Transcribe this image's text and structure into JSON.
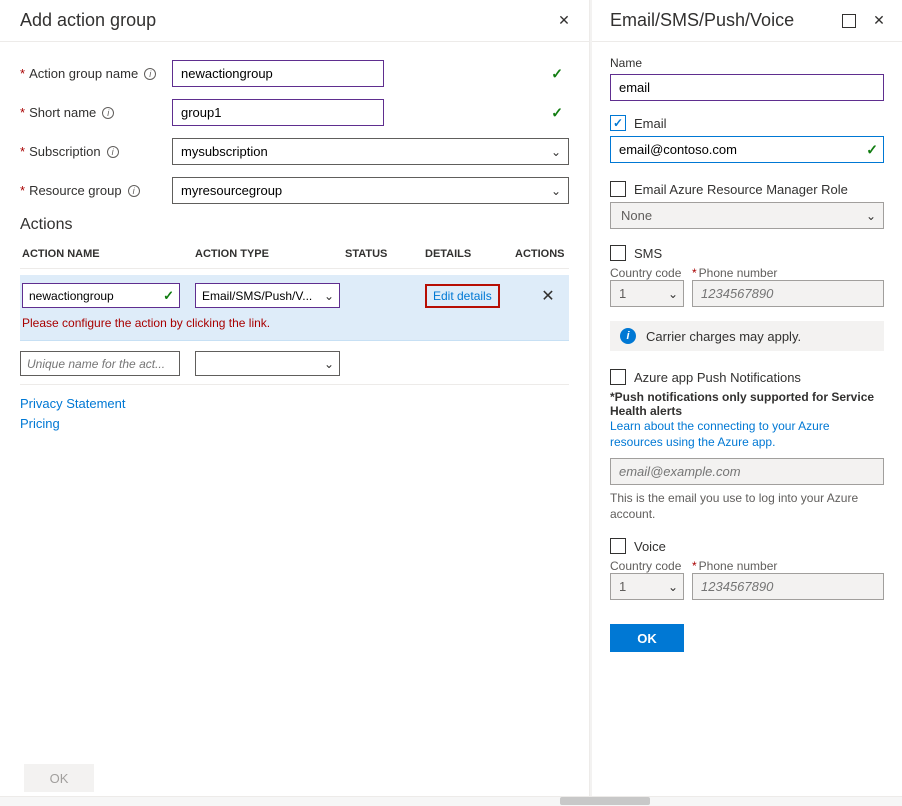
{
  "leftPane": {
    "title": "Add action group",
    "fields": {
      "actionGroupName": {
        "label": "Action group name",
        "value": "newactiongroup"
      },
      "shortName": {
        "label": "Short name",
        "value": "group1"
      },
      "subscription": {
        "label": "Subscription",
        "value": "mysubscription"
      },
      "resourceGroup": {
        "label": "Resource group",
        "value": "myresourcegroup"
      }
    },
    "actionsHeading": "Actions",
    "table": {
      "headers": {
        "name": "ACTION NAME",
        "type": "ACTION TYPE",
        "status": "STATUS",
        "details": "DETAILS",
        "actions": "ACTIONS"
      },
      "row1": {
        "name": "newactiongroup",
        "type": "Email/SMS/Push/V...",
        "editLink": "Edit details"
      },
      "errorMsg": "Please configure the action by clicking the link.",
      "row2": {
        "placeholder": "Unique name for the act..."
      }
    },
    "links": {
      "privacy": "Privacy Statement",
      "pricing": "Pricing"
    },
    "okLabel": "OK"
  },
  "rightPane": {
    "title": "Email/SMS/Push/Voice",
    "nameLabel": "Name",
    "nameValue": "email",
    "email": {
      "label": "Email",
      "value": "email@contoso.com"
    },
    "armRole": {
      "label": "Email Azure Resource Manager Role",
      "value": "None"
    },
    "sms": {
      "label": "SMS",
      "ccLabel": "Country code",
      "phoneLabel": "Phone number",
      "cc": "1",
      "placeholder": "1234567890"
    },
    "carrierNote": "Carrier charges may apply.",
    "push": {
      "label": "Azure app Push Notifications",
      "note": "*Push notifications only supported for Service Health alerts",
      "learn": "Learn about the connecting to your Azure resources using the Azure app.",
      "placeholder": "email@example.com",
      "helper": "This is the email you use to log into your Azure account."
    },
    "voice": {
      "label": "Voice",
      "ccLabel": "Country code",
      "phoneLabel": "Phone number",
      "cc": "1",
      "placeholder": "1234567890"
    },
    "okLabel": "OK"
  }
}
